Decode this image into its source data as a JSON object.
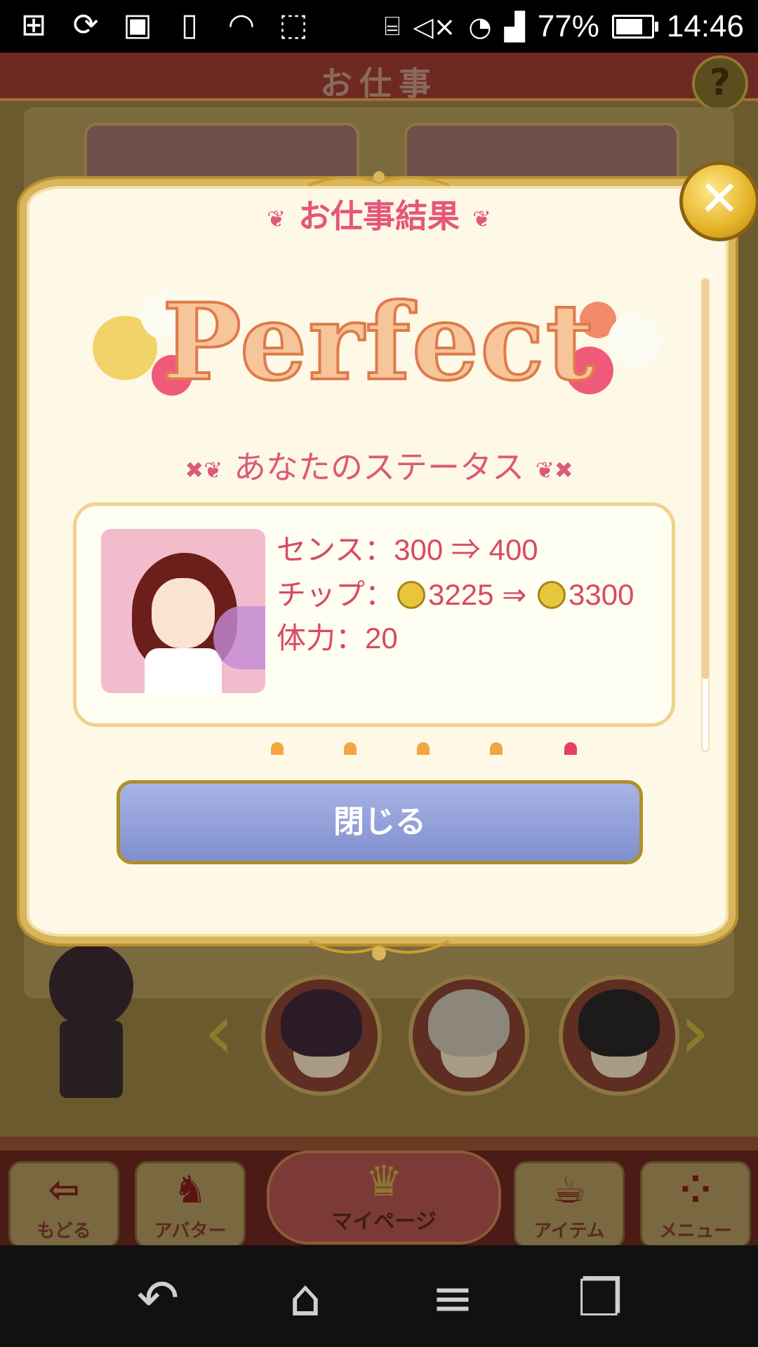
{
  "status_bar": {
    "battery_percent": "77%",
    "time": "14:46",
    "battery_level": 0.77,
    "left_icons": [
      "add-icon",
      "sync-icon",
      "image-icon",
      "phone-sync-icon",
      "nfc-icon",
      "rotate-icon"
    ],
    "right_icons": [
      "vr-icon",
      "mute-icon",
      "wifi-icon",
      "signal-icon",
      "battery-icon"
    ]
  },
  "game": {
    "header_title": "お仕事",
    "help_glyph": "?"
  },
  "modal": {
    "title": "お仕事結果",
    "result": "Perfect",
    "status_heading": "あなたのステータス",
    "stats": {
      "sense_label": "センス：",
      "sense_value": "300 ⇒ 400",
      "tip_label": "チップ：",
      "tip_from": "3225",
      "arrow": "⇒",
      "tip_to": "3300",
      "stamina_label": "体力：",
      "stamina_value": "20"
    },
    "close_button": "閉じる",
    "close_glyph": "✕"
  },
  "bottom_nav": {
    "back": "もどる",
    "avatar": "アバター",
    "mypage": "マイページ",
    "item": "アイテム",
    "menu": "メニュー"
  },
  "colors": {
    "accent_pink": "#e5567a",
    "gold": "#d9b55b",
    "button_blue": "#8f9dd8"
  }
}
